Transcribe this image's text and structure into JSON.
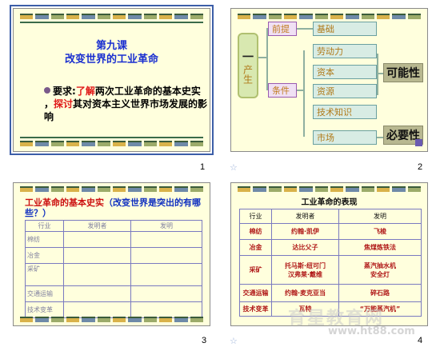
{
  "slides": [
    {
      "number": "1",
      "title_line1": "第九课",
      "title_line2": "改变世界的工业革命",
      "body_prefix": "要求:",
      "body_red1": "了解",
      "body_mid": "两次工业革命的基本史实 ，",
      "body_red2": "探讨",
      "body_end": "其对资本主义世界市场发展的影响"
    },
    {
      "number": "2",
      "producer": "产生",
      "premise": "前提",
      "condition": "条件",
      "items": [
        "基础",
        "劳动力",
        "资本",
        "资源",
        "技术知识",
        "市场"
      ],
      "possibility": "可能性",
      "necessity": "必要性"
    },
    {
      "number": "3",
      "title_red": "工业革命的基本史实",
      "title_blue": "（改变世界是突出的有哪些？）",
      "headers": [
        "行业",
        "发明者",
        "发明"
      ],
      "rows": [
        "棉纺",
        "冶金",
        "采矿",
        "交通运输",
        "技术变革"
      ]
    },
    {
      "number": "4",
      "title": "工业革命的表现",
      "headers": [
        "行业",
        "发明者",
        "发明"
      ],
      "rows": [
        [
          "棉纺",
          "约翰·凯伊",
          "飞梭"
        ],
        [
          "冶金",
          "达比父子",
          "焦煤炼铁法"
        ],
        [
          "采矿",
          "托马斯·纽可门\n汉弗莱·戴维",
          "蒸汽抽水机\n安全灯"
        ],
        [
          "交通运输",
          "约翰·麦克亚当",
          "碎石路"
        ],
        [
          "技术变革",
          "瓦特",
          "“万能蒸汽机”"
        ]
      ]
    }
  ],
  "watermark": "育星教育网",
  "watermark_url": "www.ht88.com"
}
